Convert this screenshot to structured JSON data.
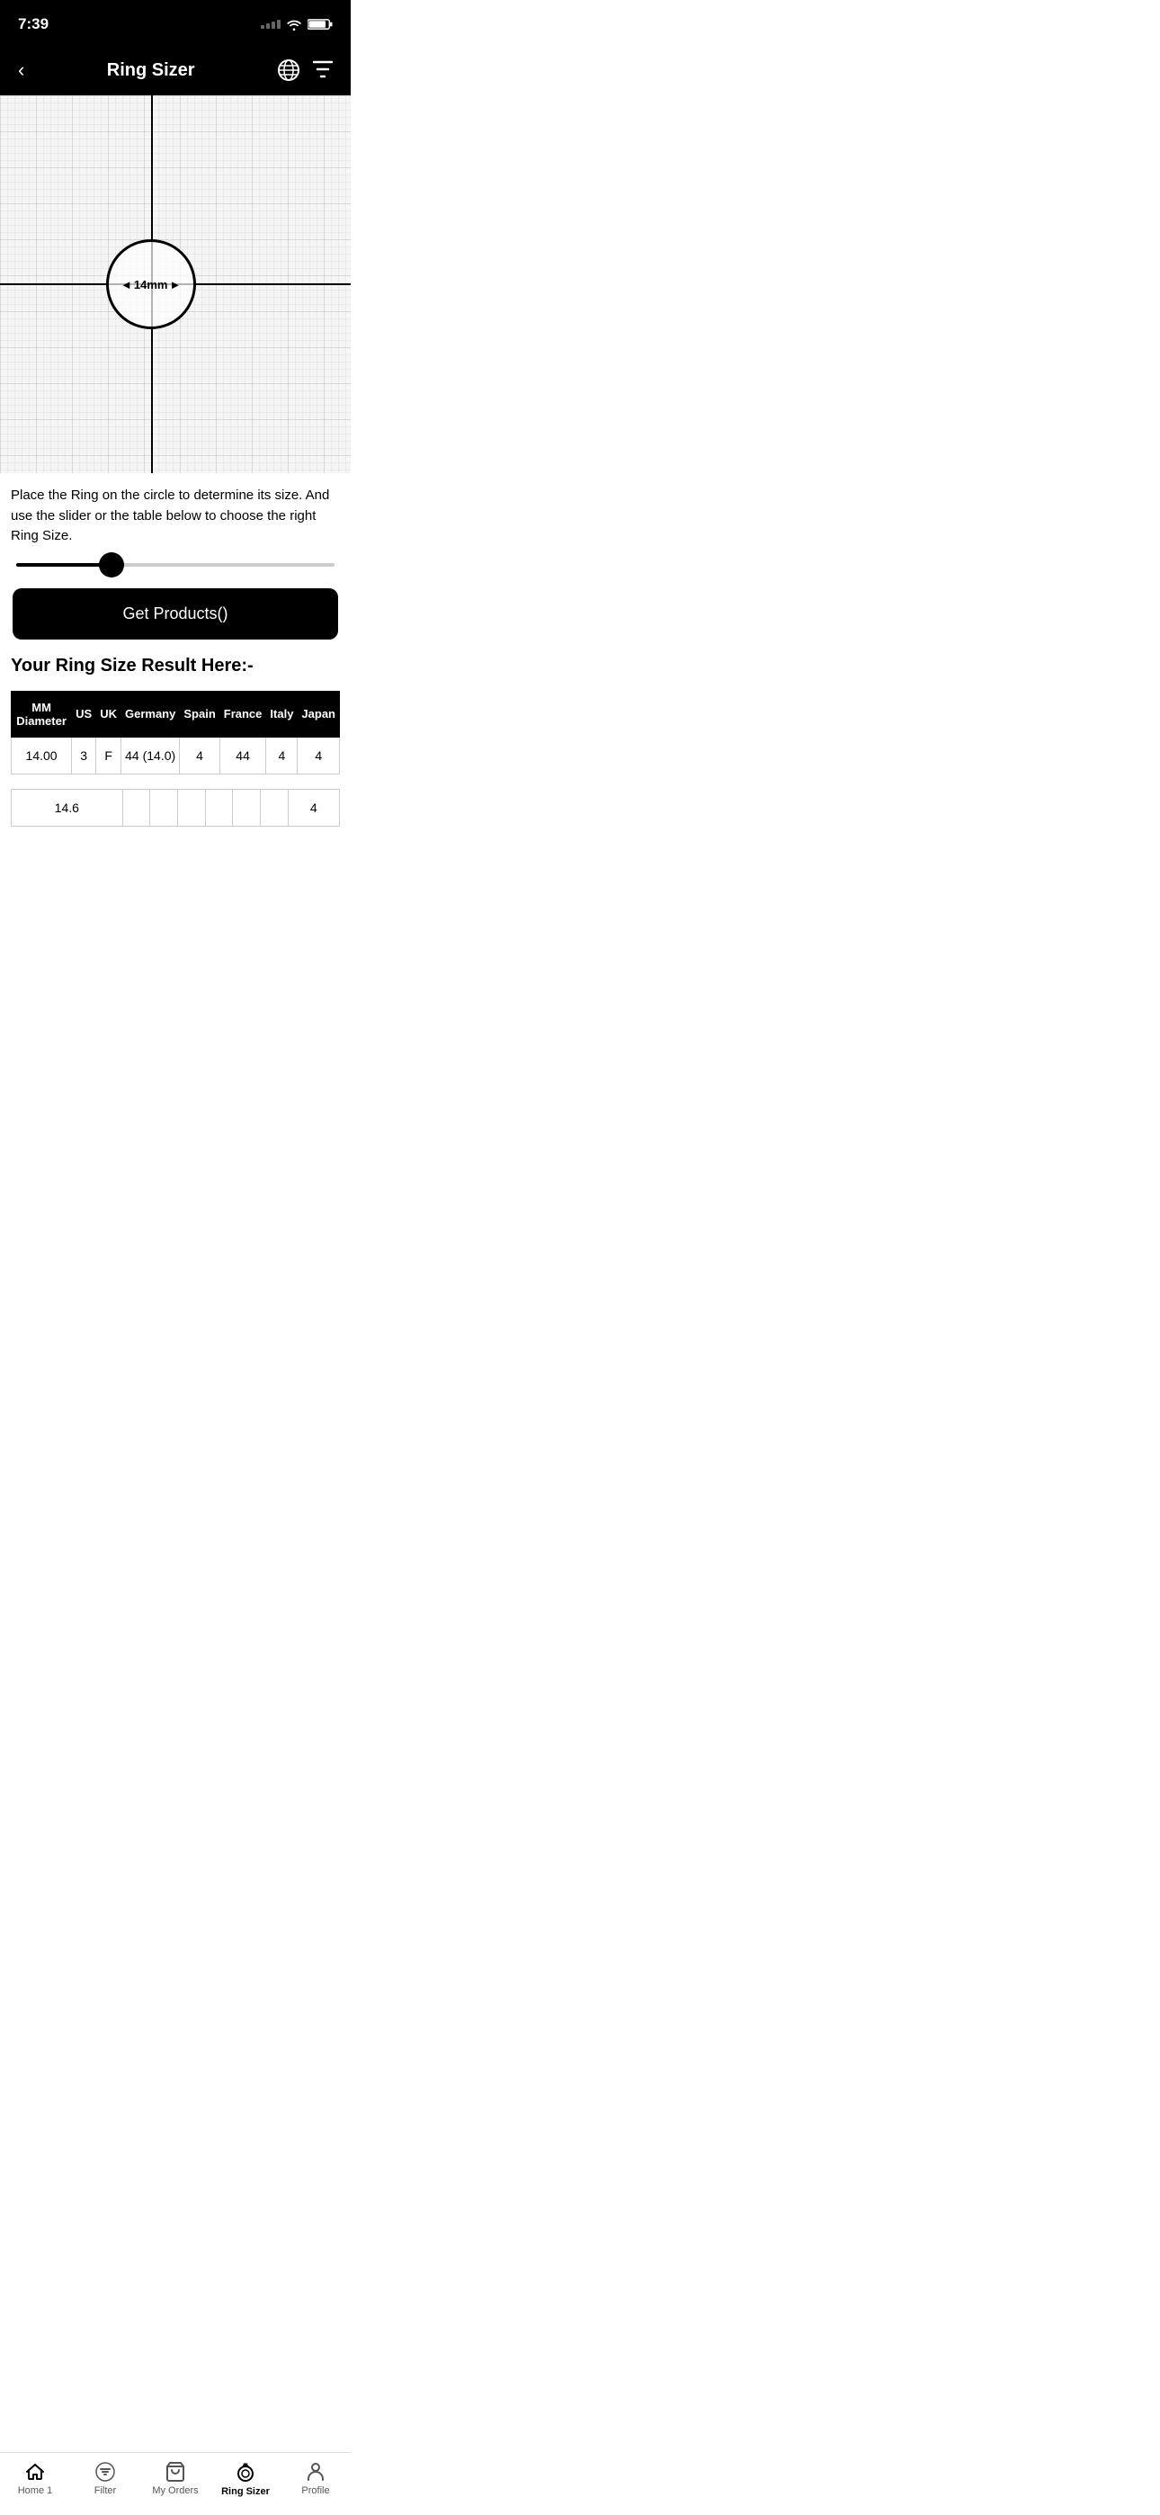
{
  "statusBar": {
    "time": "7:39"
  },
  "header": {
    "title": "Ring Sizer",
    "backLabel": "‹"
  },
  "ringCircle": {
    "diameter": "14mm",
    "arrowLeft": "◄",
    "arrowRight": "►"
  },
  "instruction": {
    "text": "Place the Ring on the circle to determine its size. And use the slider or the table below to choose the right Ring Size."
  },
  "slider": {
    "fillPercent": "30%"
  },
  "getProductsButton": {
    "label": "Get Products()"
  },
  "resultSection": {
    "title": "Your Ring Size Result Here:-",
    "tableHeaders": [
      "MM Diameter",
      "US",
      "UK",
      "Germany",
      "Spain",
      "France",
      "Italy",
      "Japan"
    ],
    "tableRows": [
      [
        "14.00",
        "3",
        "F",
        "44 (14.0)",
        "4",
        "44",
        "4",
        "4"
      ],
      [
        "14.6",
        "",
        "",
        "",
        "",
        "",
        "",
        "4"
      ]
    ]
  },
  "bottomNav": {
    "items": [
      {
        "id": "home",
        "label": "Home 1",
        "icon": "home"
      },
      {
        "id": "filter",
        "label": "Filter",
        "icon": "filter"
      },
      {
        "id": "my-orders",
        "label": "My Orders",
        "icon": "bag"
      },
      {
        "id": "ring-sizer",
        "label": "Ring Sizer",
        "icon": "ring",
        "active": true
      },
      {
        "id": "profile",
        "label": "Profile",
        "icon": "person"
      }
    ]
  }
}
